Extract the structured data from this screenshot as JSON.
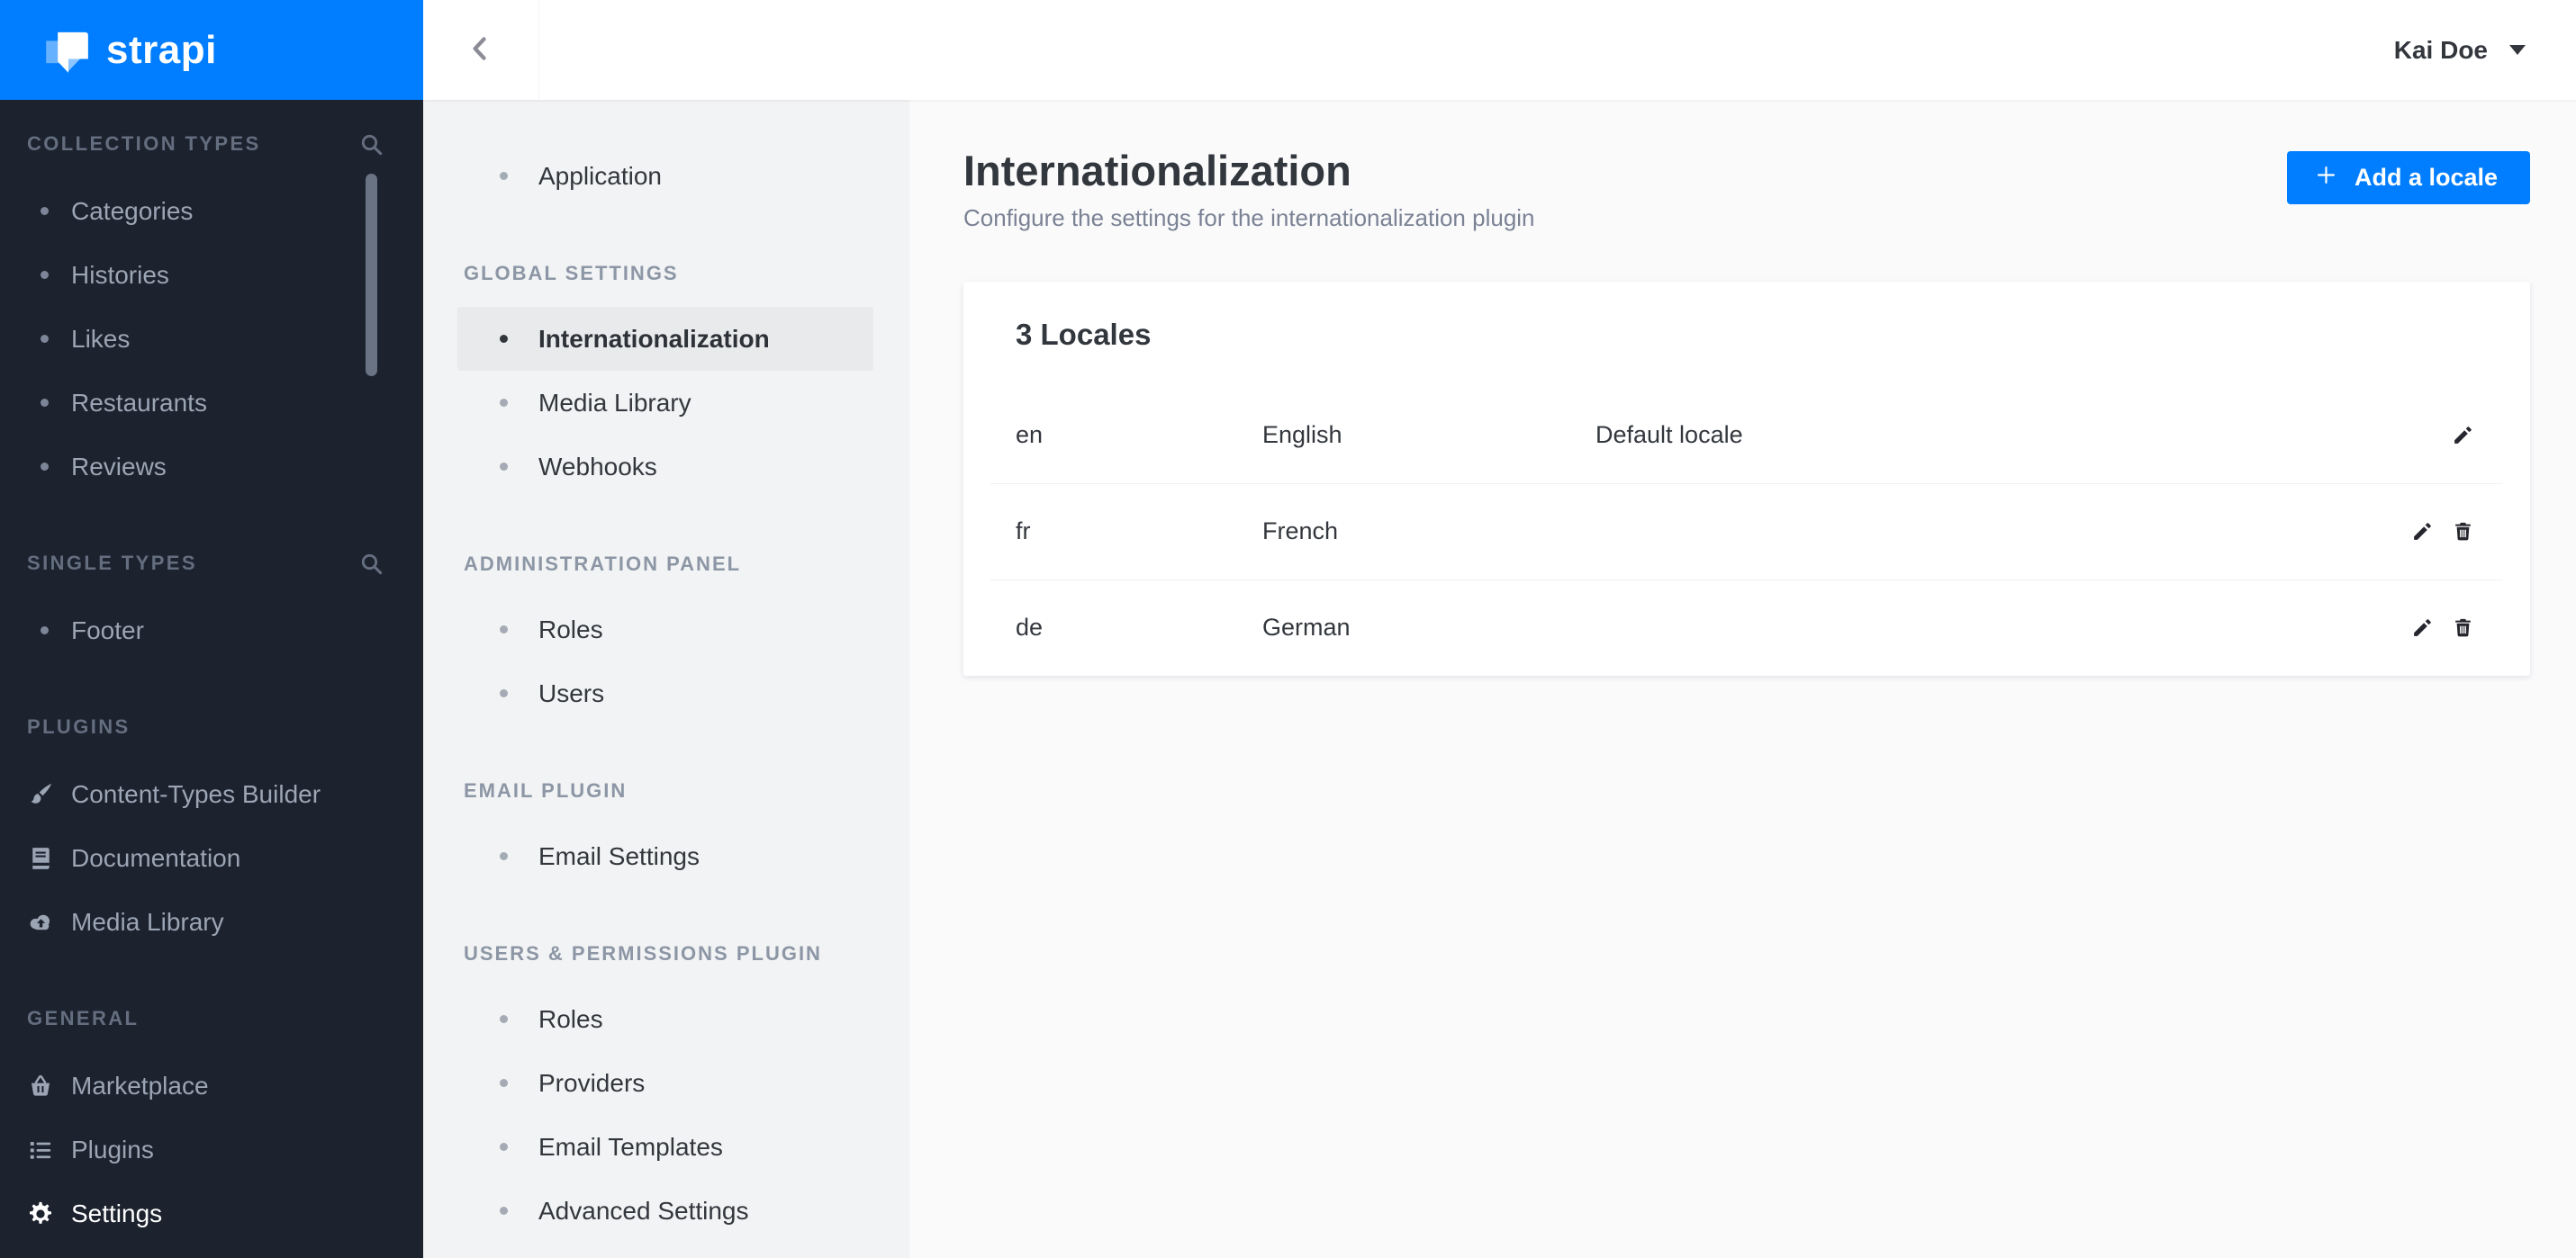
{
  "brand": {
    "name": "strapi",
    "logo_icon": "strapi-logo-icon",
    "bg_color": "#007EFF"
  },
  "topbar": {
    "back_icon": "chevron-left-icon",
    "user_name": "Kai Doe",
    "user_caret_icon": "caret-down-icon"
  },
  "sidebar": {
    "bg_color": "#1C222E",
    "sections": [
      {
        "title": "COLLECTION TYPES",
        "search_icon": "search-icon",
        "items": [
          {
            "label": "Categories"
          },
          {
            "label": "Histories"
          },
          {
            "label": "Likes"
          },
          {
            "label": "Restaurants"
          },
          {
            "label": "Reviews"
          }
        ]
      },
      {
        "title": "SINGLE TYPES",
        "search_icon": "search-icon",
        "items": [
          {
            "label": "Footer"
          }
        ]
      },
      {
        "title": "PLUGINS",
        "items": [
          {
            "label": "Content-Types Builder",
            "icon": "brush-icon"
          },
          {
            "label": "Documentation",
            "icon": "book-icon"
          },
          {
            "label": "Media Library",
            "icon": "cloud-upload-icon"
          }
        ]
      },
      {
        "title": "GENERAL",
        "items": [
          {
            "label": "Marketplace",
            "icon": "basket-icon"
          },
          {
            "label": "Plugins",
            "icon": "list-icon"
          },
          {
            "label": "Settings",
            "icon": "gear-icon",
            "active": true
          }
        ]
      }
    ]
  },
  "settings_nav": {
    "items_top": [
      {
        "label": "Application"
      }
    ],
    "groups": [
      {
        "title": "GLOBAL SETTINGS",
        "items": [
          {
            "label": "Internationalization",
            "active": true
          },
          {
            "label": "Media Library"
          },
          {
            "label": "Webhooks"
          }
        ]
      },
      {
        "title": "ADMINISTRATION PANEL",
        "items": [
          {
            "label": "Roles"
          },
          {
            "label": "Users"
          }
        ]
      },
      {
        "title": "EMAIL PLUGIN",
        "items": [
          {
            "label": "Email Settings"
          }
        ]
      },
      {
        "title": "USERS & PERMISSIONS PLUGIN",
        "items": [
          {
            "label": "Roles"
          },
          {
            "label": "Providers"
          },
          {
            "label": "Email Templates"
          },
          {
            "label": "Advanced Settings"
          }
        ]
      }
    ]
  },
  "main": {
    "title": "Internationalization",
    "subtitle": "Configure the settings for the internationalization plugin",
    "add_button_label": "Add a locale",
    "add_button_icon": "plus-icon",
    "accent_color": "#007EFF",
    "card": {
      "title": "3 Locales",
      "rows": [
        {
          "code": "en",
          "name": "English",
          "note": "Default locale",
          "actions": [
            "edit-pencil-icon"
          ]
        },
        {
          "code": "fr",
          "name": "French",
          "note": "",
          "actions": [
            "edit-pencil-icon",
            "delete-trash-icon"
          ]
        },
        {
          "code": "de",
          "name": "German",
          "note": "",
          "actions": [
            "edit-pencil-icon",
            "delete-trash-icon"
          ]
        }
      ]
    }
  }
}
